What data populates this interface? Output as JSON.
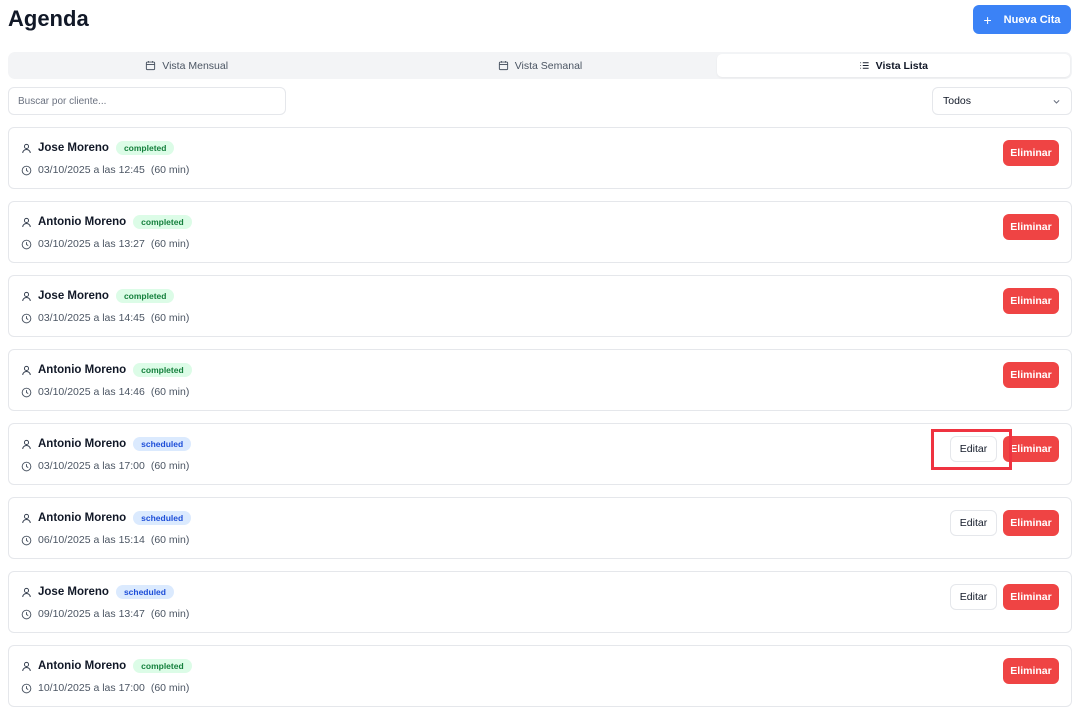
{
  "header": {
    "title": "Agenda",
    "new_button_label": "Nueva Cita",
    "new_button_icon": "plus-icon",
    "accent_color": "#3b82f6"
  },
  "tabs": [
    {
      "label": "Vista Mensual",
      "icon": "calendar-icon",
      "active": false
    },
    {
      "label": "Vista Semanal",
      "icon": "calendar-icon",
      "active": false
    },
    {
      "label": "Vista Lista",
      "icon": "list-icon",
      "active": true
    }
  ],
  "filters": {
    "search_placeholder": "Buscar por cliente...",
    "status_select_value": "Todos"
  },
  "appointments": [
    {
      "client": "Jose Moreno",
      "status": "completed",
      "datetime": "03/10/2025 a las 12:45",
      "duration": "(60 min)",
      "edit_label": "",
      "delete_label": "Eliminar"
    },
    {
      "client": "Antonio Moreno",
      "status": "completed",
      "datetime": "03/10/2025 a las 13:27",
      "duration": "(60 min)",
      "edit_label": "",
      "delete_label": "Eliminar"
    },
    {
      "client": "Jose Moreno",
      "status": "completed",
      "datetime": "03/10/2025 a las 14:45",
      "duration": "(60 min)",
      "edit_label": "",
      "delete_label": "Eliminar"
    },
    {
      "client": "Antonio Moreno",
      "status": "completed",
      "datetime": "03/10/2025 a las 14:46",
      "duration": "(60 min)",
      "edit_label": "",
      "delete_label": "Eliminar"
    },
    {
      "client": "Antonio Moreno",
      "status": "scheduled",
      "datetime": "03/10/2025 a las 17:00",
      "duration": "(60 min)",
      "edit_label": "Editar",
      "delete_label": "Eliminar"
    },
    {
      "client": "Antonio Moreno",
      "status": "scheduled",
      "datetime": "06/10/2025 a las 15:14",
      "duration": "(60 min)",
      "edit_label": "Editar",
      "delete_label": "Eliminar"
    },
    {
      "client": "Jose Moreno",
      "status": "scheduled",
      "datetime": "09/10/2025 a las 13:47",
      "duration": "(60 min)",
      "edit_label": "Editar",
      "delete_label": "Eliminar"
    },
    {
      "client": "Antonio Moreno",
      "status": "completed",
      "datetime": "10/10/2025 a las 17:00",
      "duration": "(60 min)",
      "edit_label": "",
      "delete_label": "Eliminar"
    }
  ],
  "colors": {
    "delete": "#ef4444",
    "completed_badge_bg": "#dcfce7",
    "completed_badge_text": "#15803d",
    "scheduled_badge_bg": "#dbeafe",
    "scheduled_badge_text": "#1d4ed8",
    "highlight": "#ef3340"
  }
}
